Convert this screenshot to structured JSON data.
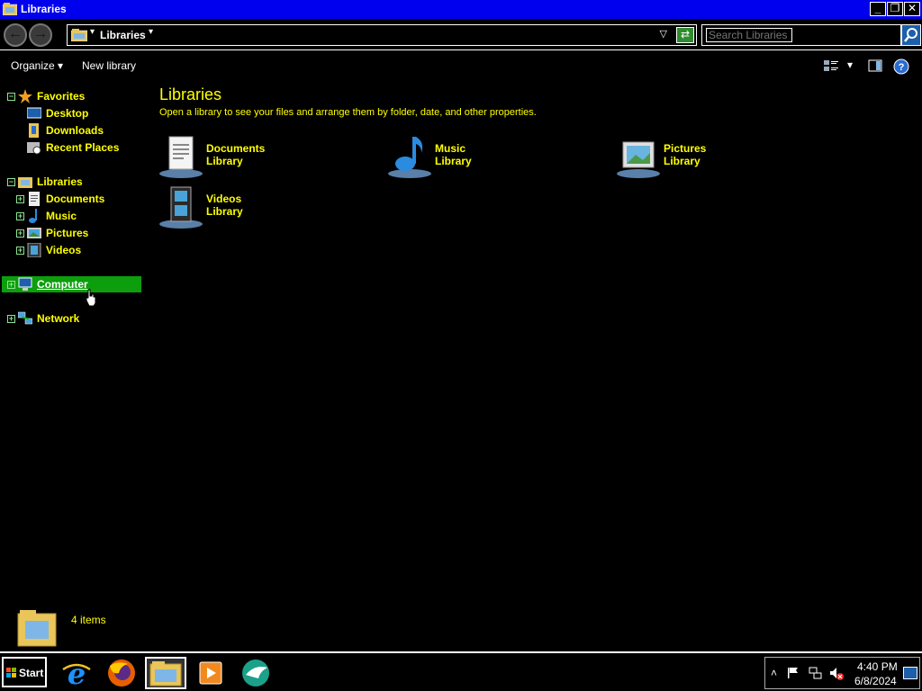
{
  "window": {
    "title": "Libraries",
    "minimize": "_",
    "restore": "❐",
    "close": "✕"
  },
  "address": {
    "back_glyph": "←",
    "forward_glyph": "→",
    "path": "Libraries",
    "search_placeholder": "Search Libraries"
  },
  "commands": {
    "organize": "Organize",
    "new_library": "New library"
  },
  "nav": {
    "favorites": "Favorites",
    "favorites_items": [
      "Desktop",
      "Downloads",
      "Recent Places"
    ],
    "libraries": "Libraries",
    "libraries_items": [
      "Documents",
      "Music",
      "Pictures",
      "Videos"
    ],
    "computer": "Computer",
    "network": "Network"
  },
  "main": {
    "title": "Libraries",
    "subtitle": "Open a library to see your files and arrange them by folder, date, and other properties.",
    "libraries": [
      {
        "name": "Documents",
        "type": "Library",
        "icon": "documents-icon"
      },
      {
        "name": "Music",
        "type": "Library",
        "icon": "music-icon"
      },
      {
        "name": "Pictures",
        "type": "Library",
        "icon": "pictures-icon"
      },
      {
        "name": "Videos",
        "type": "Library",
        "icon": "videos-icon"
      }
    ]
  },
  "details": {
    "count": "4 items"
  },
  "taskbar": {
    "start": "Start",
    "apps": [
      "internet-explorer-icon",
      "firefox-icon",
      "file-explorer-icon",
      "media-player-icon",
      "bird-app-icon"
    ],
    "time": "4:40 PM",
    "date": "6/8/2024"
  },
  "colors": {
    "titlebar": "#0000ee",
    "text_accent": "#ffff00",
    "selected_bg": "#0c9e0c"
  }
}
